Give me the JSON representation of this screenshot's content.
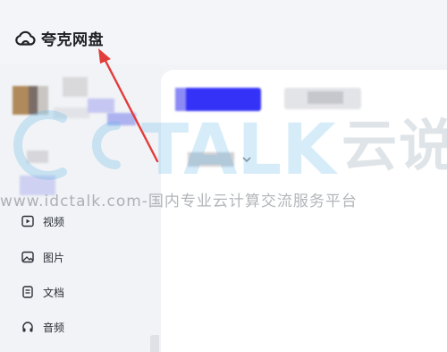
{
  "app": {
    "brand": "夸克网盘",
    "brand_icon": "cloud-icon"
  },
  "sidebar": {
    "items": [
      {
        "label": "视频",
        "icon": "video-icon"
      },
      {
        "label": "图片",
        "icon": "image-icon"
      },
      {
        "label": "文档",
        "icon": "document-icon"
      },
      {
        "label": "音频",
        "icon": "headphones-icon"
      }
    ]
  },
  "watermark": {
    "logo_text": "TALK",
    "cn_text": "云说",
    "line": "www.idctalk.com-国内专业云计算交流服务平台"
  },
  "colors": {
    "accent": "#3432f6",
    "annotation_arrow": "#e23b3b",
    "watermark_blue": "#5fb6e6"
  }
}
